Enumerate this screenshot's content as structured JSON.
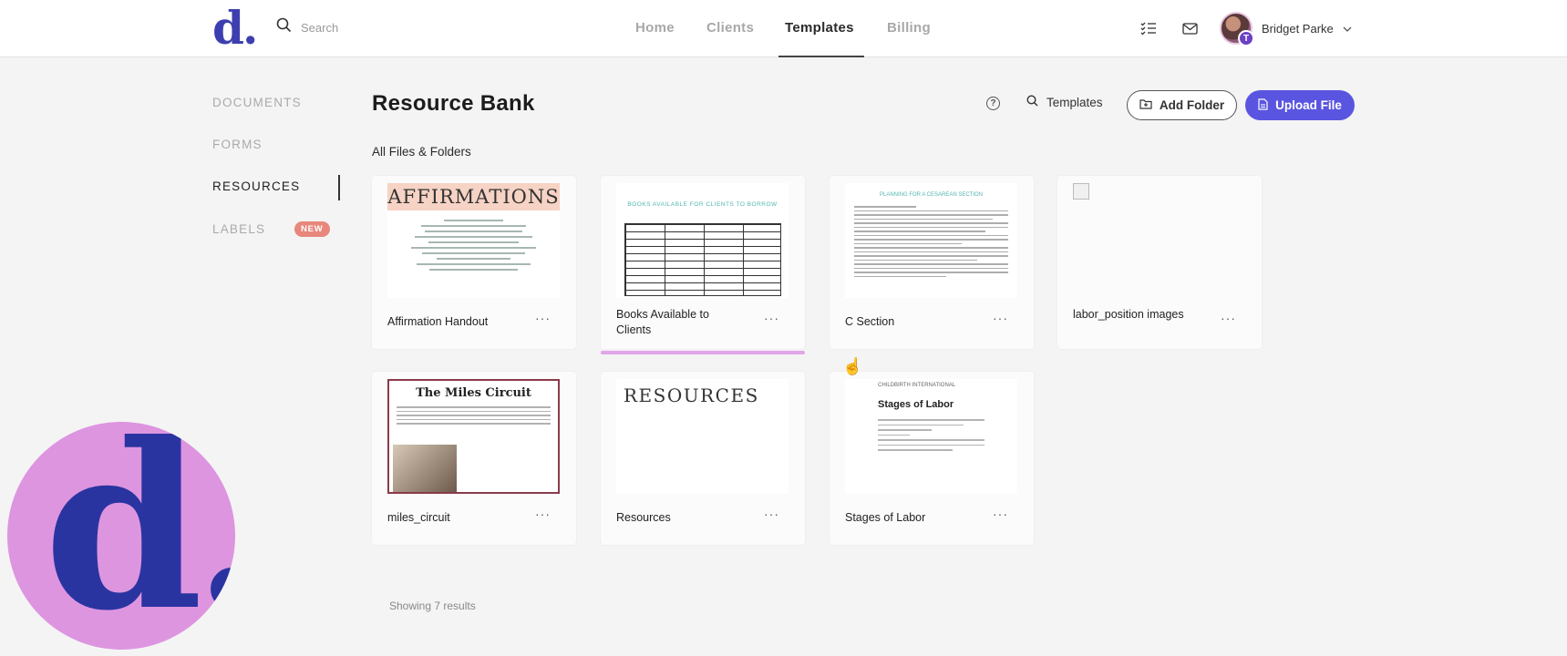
{
  "header": {
    "logo_text": "d.",
    "search_placeholder": "Search",
    "nav": [
      {
        "label": "Home"
      },
      {
        "label": "Clients"
      },
      {
        "label": "Templates"
      },
      {
        "label": "Billing"
      }
    ],
    "active_nav": "Templates",
    "user": {
      "name": "Bridget Parke",
      "badge": "T"
    }
  },
  "sidebar": {
    "items": [
      {
        "label": "DOCUMENTS"
      },
      {
        "label": "FORMS"
      },
      {
        "label": "RESOURCES"
      },
      {
        "label": "LABELS"
      }
    ],
    "active": "RESOURCES",
    "labels_badge": "NEW"
  },
  "main": {
    "title": "Resource Bank",
    "section_label": "All Files & Folders",
    "search_label": "Templates",
    "add_folder_label": "Add Folder",
    "upload_file_label": "Upload File",
    "files": [
      {
        "name": "Affirmation Handout",
        "thumb_title": "AFFIRMATIONS"
      },
      {
        "name": "Books Available to Clients",
        "thumb_title": "BOOKS AVAILABLE FOR CLIENTS TO BORROW"
      },
      {
        "name": "C Section",
        "thumb_title": "PLANNING FOR A CESAREAN SECTION"
      },
      {
        "name": "labor_position images"
      },
      {
        "name": "miles_circuit",
        "thumb_title": "The Miles Circuit"
      },
      {
        "name": "Resources",
        "thumb_title": "RESOURCES"
      },
      {
        "name": "Stages of Labor",
        "thumb_title": "Stages of Labor",
        "thumb_brand": "CHILDBIRTH INTERNATIONAL"
      }
    ],
    "more_label": "···",
    "results_text": "Showing 7 results"
  },
  "overlay_logo": {
    "text": "d."
  },
  "colors": {
    "accent": "#5a55e0",
    "brand_blue": "#3d3fb0",
    "brand_pink": "#dd95e0",
    "badge_new": "#e8877c"
  }
}
